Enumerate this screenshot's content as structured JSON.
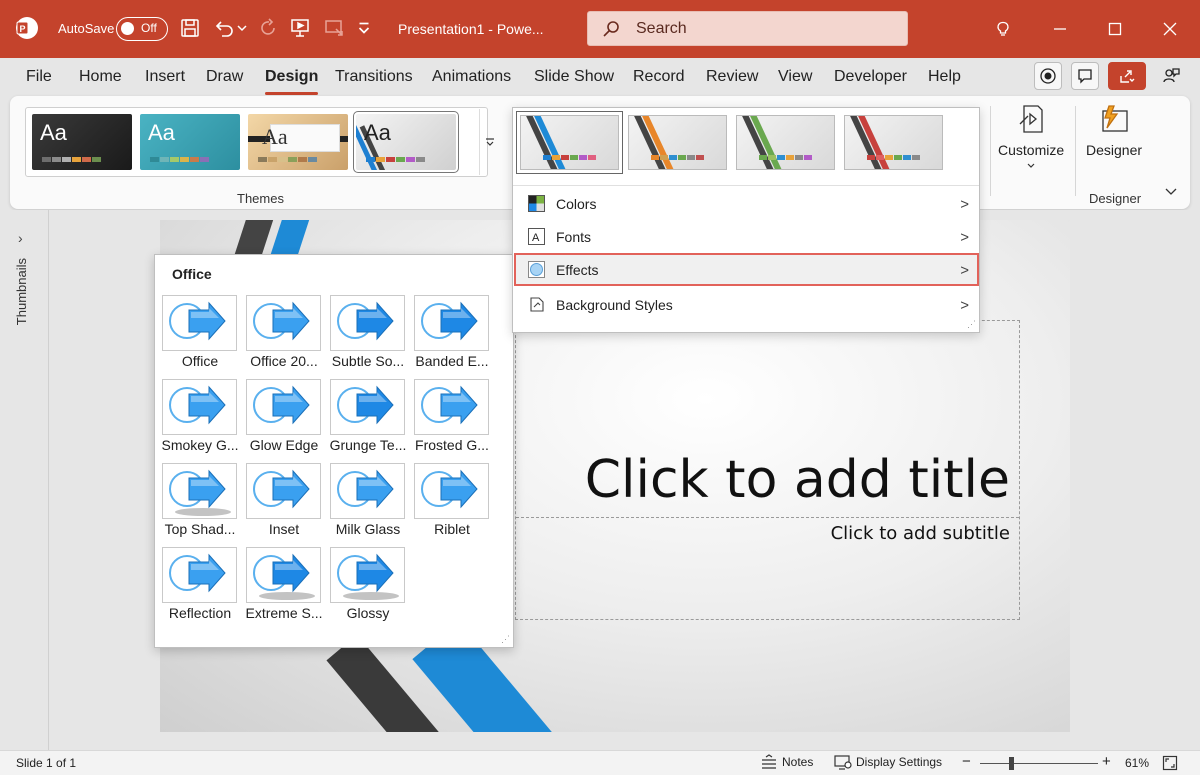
{
  "titlebar": {
    "autosave_label": "AutoSave",
    "autosave_state": "Off",
    "document_title": "Presentation1  -  Powe...",
    "search_placeholder": "Search"
  },
  "tabs": [
    "File",
    "Home",
    "Insert",
    "Draw",
    "Design",
    "Transitions",
    "Animations",
    "Slide Show",
    "Record",
    "Review",
    "View",
    "Developer",
    "Help"
  ],
  "active_tab": "Design",
  "ribbon": {
    "themes_label": "Themes",
    "theme_tiles": [
      {
        "text": "Aa",
        "colors": [
          "#6d6d6d",
          "#8b8b8b",
          "#b0b0b0",
          "#e7a33c",
          "#d06a4a",
          "#6b8e4e"
        ]
      },
      {
        "text": "Aa",
        "colors": [
          "#2f8a96",
          "#6fb5b7",
          "#a4c96a",
          "#d9b44a",
          "#c77b4a",
          "#8a6fb5"
        ]
      },
      {
        "text": "Aa",
        "colors": [
          "#8a7a5a",
          "#c9a36a",
          "#d8c08a",
          "#8aa05a",
          "#b07a4a",
          "#6a8aa0"
        ]
      },
      {
        "text": "Aa",
        "colors": [
          "#1e7fd1",
          "#e8a23a",
          "#c7413d",
          "#6aa84f",
          "#b25bc7",
          "#8a8a8a"
        ]
      }
    ],
    "customize_label": "Customize",
    "designer_label": "Designer",
    "designer_group_label": "Designer"
  },
  "variants_menu": {
    "items": [
      {
        "label": "Colors",
        "icon": "colors-icon"
      },
      {
        "label": "Fonts",
        "icon": "fonts-icon"
      },
      {
        "label": "Effects",
        "icon": "effects-icon"
      },
      {
        "label": "Background Styles",
        "icon": "background-styles-icon"
      }
    ],
    "highlighted": "Effects"
  },
  "effects_gallery": {
    "header": "Office",
    "items": [
      "Office",
      "Office 20...",
      "Subtle So...",
      "Banded E...",
      "Smokey G...",
      "Glow Edge",
      "Grunge Te...",
      "Frosted G...",
      "Top Shad...",
      "Inset",
      "Milk Glass",
      "Riblet",
      "Reflection",
      "Extreme S...",
      "Glossy"
    ]
  },
  "thumbnails_label": "Thumbnails",
  "slide": {
    "title_placeholder": "Click to add title",
    "subtitle_placeholder": "Click to add subtitle"
  },
  "statusbar": {
    "slide_info": "Slide 1 of 1",
    "notes_label": "Notes",
    "display_settings_label": "Display Settings",
    "zoom_level": "61%",
    "zoom_minus": "−",
    "zoom_plus": "+"
  },
  "colors": {
    "accent": "#c4432c",
    "highlight_border": "#e2625a"
  }
}
